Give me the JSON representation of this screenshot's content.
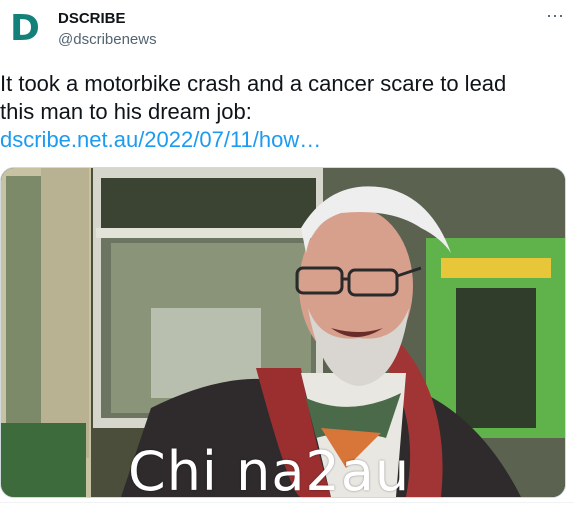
{
  "author": {
    "avatar_letter": "D",
    "name": "DSCRIBE",
    "handle": "@dscribenews"
  },
  "more_icon": "⋯",
  "tweet": {
    "line1": "It took a motorbike crash and a cancer scare to lead",
    "line2": "this man to his dream job:",
    "link": "dscribe.net.au/2022/07/11/how…"
  },
  "media": {
    "watermark": "Chi na2au"
  },
  "colors": {
    "accent": "#1d9bf0",
    "avatar": "#13807a"
  }
}
